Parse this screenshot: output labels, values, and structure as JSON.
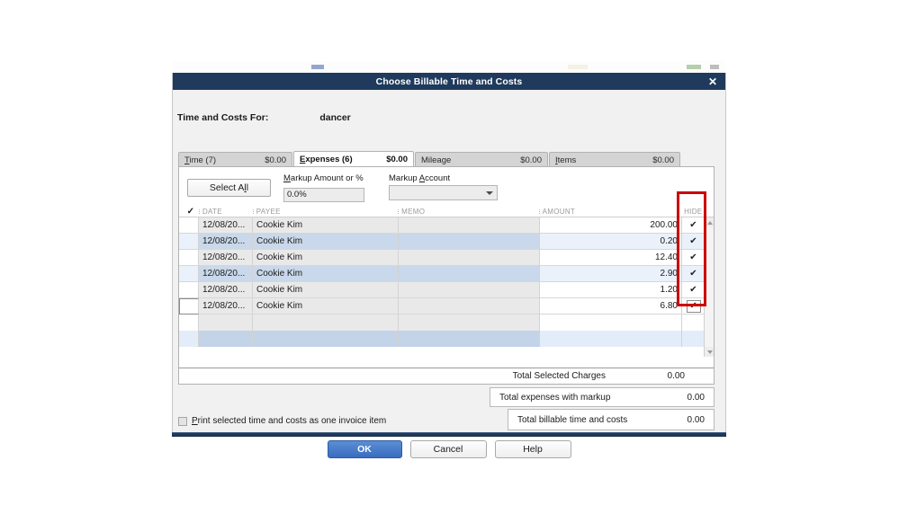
{
  "dialog": {
    "title": "Choose Billable Time and Costs",
    "close_icon": "close-icon",
    "for_label": "Time and Costs For:",
    "for_value": "dancer"
  },
  "tabs": [
    {
      "name": "Time (7)",
      "amount": "$0.00",
      "active": false
    },
    {
      "name": "Expenses (6)",
      "amount": "$0.00",
      "active": true
    },
    {
      "name": "Mileage",
      "amount": "$0.00",
      "active": false
    },
    {
      "name": "Items",
      "amount": "$0.00",
      "active": false
    }
  ],
  "toolbar": {
    "select_all_label": "Select All",
    "markup_amount_label": "Markup Amount or %",
    "markup_amount_value": "0.0%",
    "markup_account_label": "Markup Account",
    "markup_account_value": "",
    "dropdown_icon": "chevron-down-icon"
  },
  "grid": {
    "headers": {
      "check": "✓",
      "date": "DATE",
      "payee": "PAYEE",
      "memo": "MEMO",
      "amount": "AMOUNT",
      "hide": "HIDE"
    },
    "rows": [
      {
        "checked": "",
        "date": "12/08/20...",
        "payee": "Cookie Kim",
        "memo": "",
        "amount": "200.00",
        "hide": "✔"
      },
      {
        "checked": "",
        "date": "12/08/20...",
        "payee": "Cookie Kim",
        "memo": "",
        "amount": "0.20",
        "hide": "✔"
      },
      {
        "checked": "",
        "date": "12/08/20...",
        "payee": "Cookie Kim",
        "memo": "",
        "amount": "12.40",
        "hide": "✔"
      },
      {
        "checked": "",
        "date": "12/08/20...",
        "payee": "Cookie Kim",
        "memo": "",
        "amount": "2.90",
        "hide": "✔"
      },
      {
        "checked": "",
        "date": "12/08/20...",
        "payee": "Cookie Kim",
        "memo": "",
        "amount": "1.20",
        "hide": "✔"
      },
      {
        "checked": "",
        "date": "12/08/20...",
        "payee": "Cookie Kim",
        "memo": "",
        "amount": "6.80",
        "hide": "✔"
      }
    ],
    "total_selected_label": "Total Selected Charges",
    "total_selected_value": "0.00"
  },
  "totals": {
    "markup_label": "Total expenses with markup",
    "markup_value": "0.00",
    "billable_label": "Total billable time and costs",
    "billable_value": "0.00"
  },
  "options": {
    "print_one_item_label": "Print selected time and costs as one invoice item",
    "print_one_item_checked": false
  },
  "buttons": {
    "ok": "OK",
    "cancel": "Cancel",
    "help": "Help"
  },
  "annotation": {
    "color": "#cc0000",
    "target": "hide-column"
  }
}
